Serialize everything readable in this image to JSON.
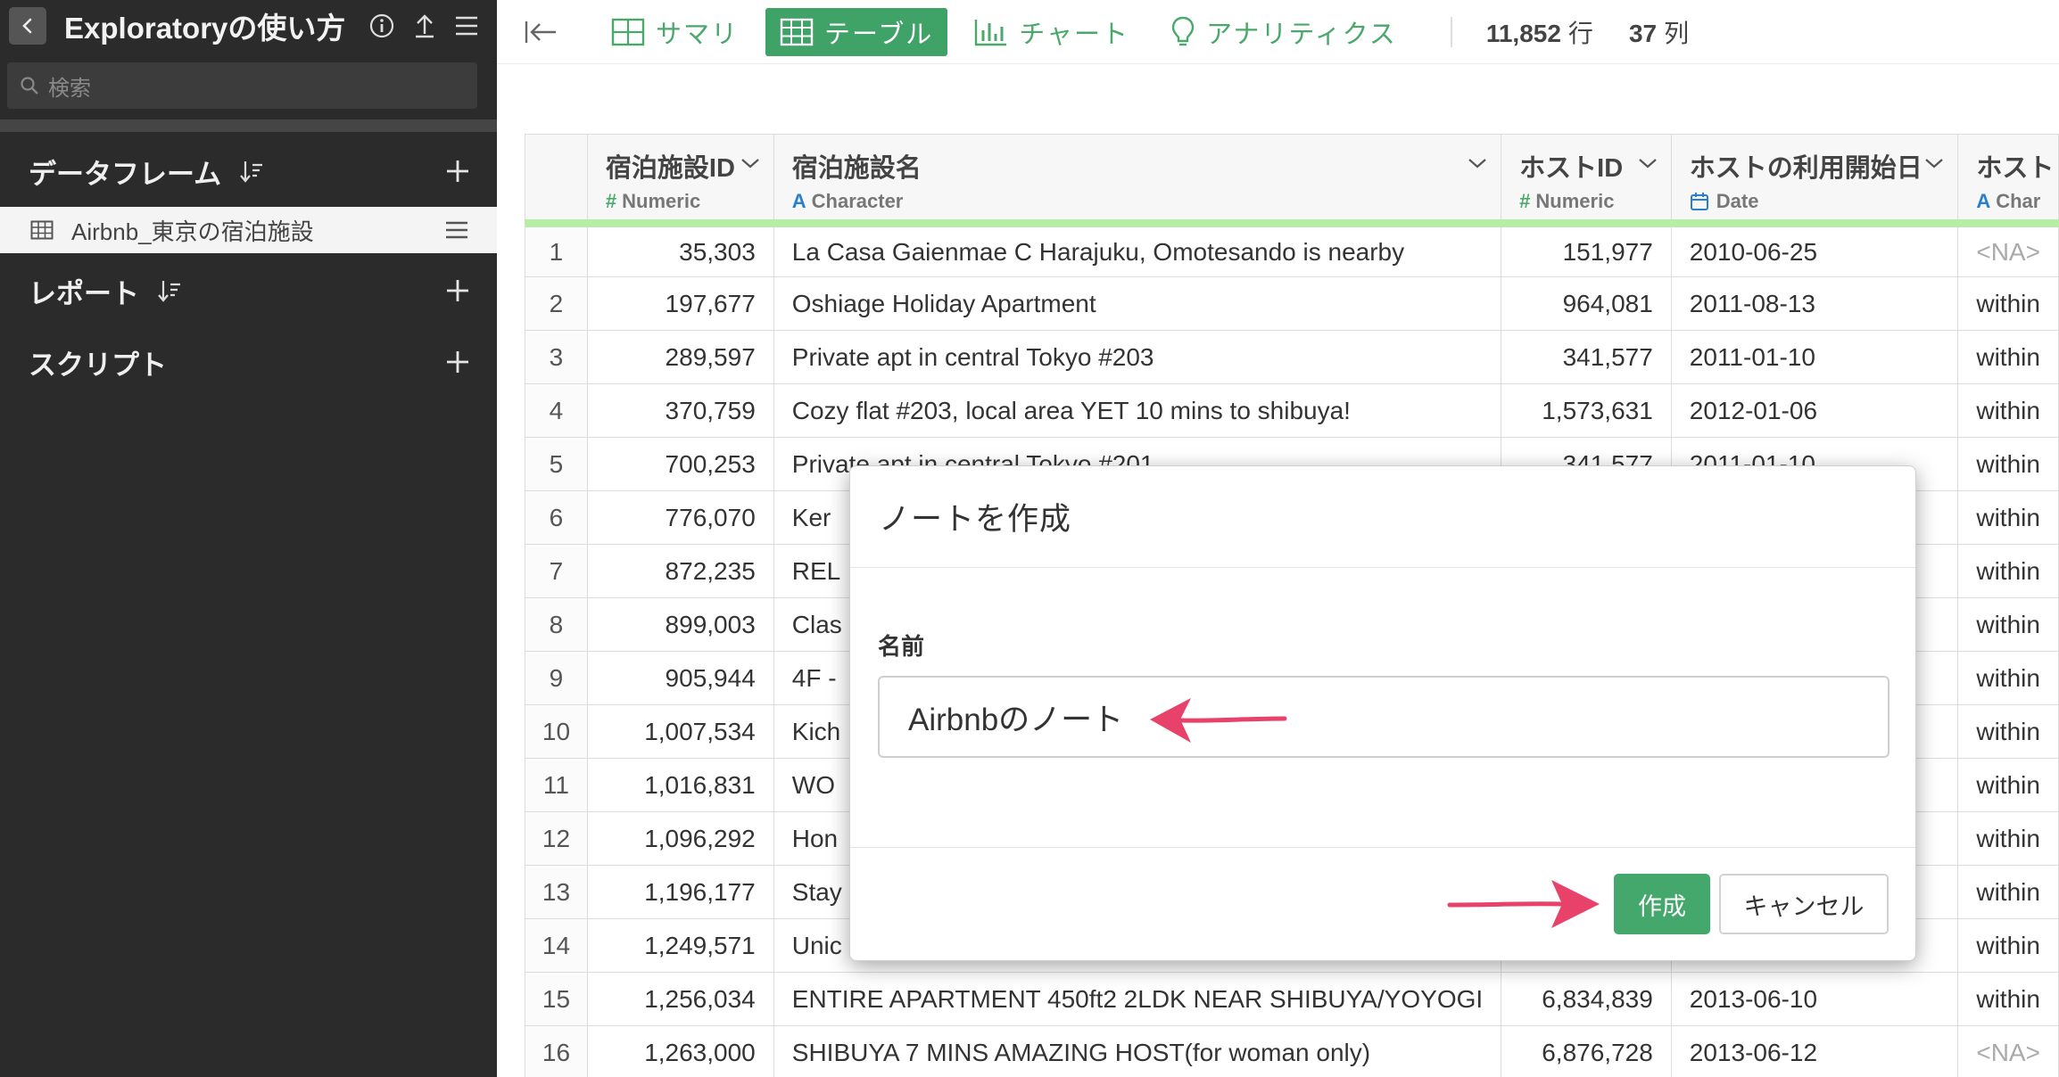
{
  "sidebar": {
    "title": "Exploratoryの使い方",
    "search_placeholder": "検索",
    "sections": {
      "dataframe": "データフレーム",
      "report": "レポート",
      "script": "スクリプト"
    },
    "dataframe_item": "Airbnb_東京の宿泊施設"
  },
  "toolbar": {
    "tabs": {
      "summary": "サマリ",
      "table": "テーブル",
      "chart": "チャート",
      "analytics": "アナリティクス"
    },
    "rows_value": "11,852",
    "rows_unit": "行",
    "cols_value": "37",
    "cols_unit": "列"
  },
  "table": {
    "columns": [
      {
        "name": "宿泊施設ID",
        "type": "Numeric",
        "type_glyph": "#"
      },
      {
        "name": "宿泊施設名",
        "type": "Character",
        "type_glyph": "A"
      },
      {
        "name": "ホストID",
        "type": "Numeric",
        "type_glyph": "#"
      },
      {
        "name": "ホストの利用開始日",
        "type": "Date",
        "type_glyph": "calendar-icon"
      },
      {
        "name": "ホスト",
        "type": "Char",
        "type_glyph": "A"
      }
    ],
    "rows": [
      {
        "n": "1",
        "id": "35,303",
        "name": "La Casa Gaienmae C Harajuku, Omotesando is nearby",
        "host": "151,977",
        "date": "2010-06-25",
        "resp": "<NA>"
      },
      {
        "n": "2",
        "id": "197,677",
        "name": "Oshiage Holiday Apartment",
        "host": "964,081",
        "date": "2011-08-13",
        "resp": "within"
      },
      {
        "n": "3",
        "id": "289,597",
        "name": "Private apt in central Tokyo #203",
        "host": "341,577",
        "date": "2011-01-10",
        "resp": "within"
      },
      {
        "n": "4",
        "id": "370,759",
        "name": "Cozy flat #203, local area YET 10 mins to shibuya!",
        "host": "1,573,631",
        "date": "2012-01-06",
        "resp": "within"
      },
      {
        "n": "5",
        "id": "700,253",
        "name": "Private apt in central Tokyo #201",
        "host": "341,577",
        "date": "2011-01-10",
        "resp": "within"
      },
      {
        "n": "6",
        "id": "776,070",
        "name": "Ker",
        "host": "",
        "date": "",
        "resp": "within"
      },
      {
        "n": "7",
        "id": "872,235",
        "name": "REL",
        "host": "",
        "date": "",
        "resp": "within"
      },
      {
        "n": "8",
        "id": "899,003",
        "name": "Clas",
        "host": "",
        "date": "",
        "resp": "within"
      },
      {
        "n": "9",
        "id": "905,944",
        "name": "4F -",
        "host": "",
        "date": "",
        "resp": "within"
      },
      {
        "n": "10",
        "id": "1,007,534",
        "name": "Kich",
        "host": "",
        "date": "",
        "resp": "within"
      },
      {
        "n": "11",
        "id": "1,016,831",
        "name": "WO",
        "host": "",
        "date": "",
        "resp": "within"
      },
      {
        "n": "12",
        "id": "1,096,292",
        "name": "Hon",
        "host": "",
        "date": "",
        "resp": "within"
      },
      {
        "n": "13",
        "id": "1,196,177",
        "name": "Stay",
        "host": "",
        "date": "",
        "resp": "within"
      },
      {
        "n": "14",
        "id": "1,249,571",
        "name": "Unic",
        "host": "",
        "date": "",
        "resp": "within"
      },
      {
        "n": "15",
        "id": "1,256,034",
        "name": "ENTIRE APARTMENT 450ft2 2LDK NEAR SHIBUYA/YOYOGI",
        "host": "6,834,839",
        "date": "2013-06-10",
        "resp": "within"
      },
      {
        "n": "16",
        "id": "1,263,000",
        "name": "SHIBUYA 7 MINS AMAZING HOST(for woman only)",
        "host": "6,876,728",
        "date": "2013-06-12",
        "resp": "<NA>"
      }
    ]
  },
  "modal": {
    "title": "ノートを作成",
    "name_label": "名前",
    "name_value": "Airbnbのノート",
    "create_label": "作成",
    "cancel_label": "キャンセル"
  },
  "colors": {
    "sidebar_bg": "#2b2b2b",
    "accent_green": "#3fa266",
    "header_underline": "#b8eda8",
    "annotation_arrow": "#e8416a"
  }
}
